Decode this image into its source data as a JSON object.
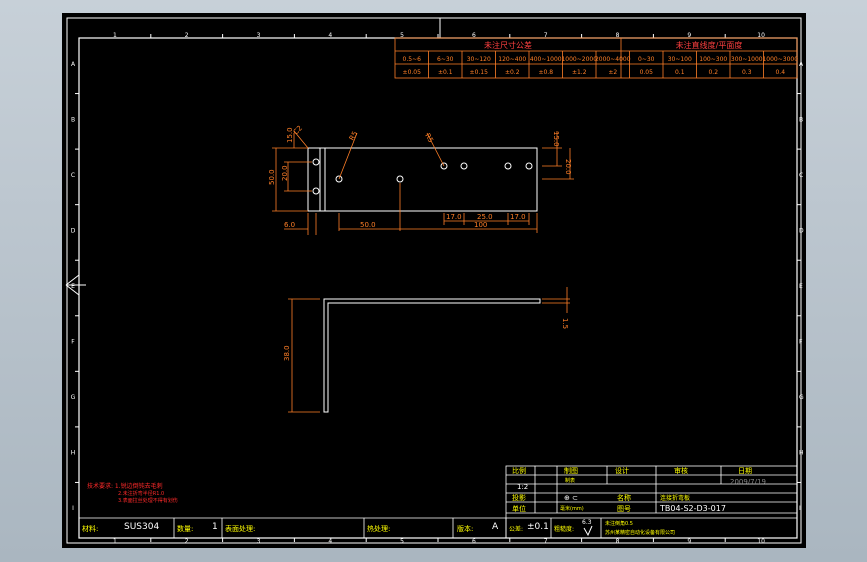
{
  "colors": {
    "sheet": "#000000",
    "frame": "#ffffff",
    "dim": "#ff7f27",
    "title": "#ffff00",
    "note": "#ff2a2a",
    "grid": "#ffffff"
  },
  "grid": {
    "columns": [
      "1",
      "2",
      "3",
      "4",
      "5",
      "6",
      "7",
      "8",
      "9",
      "10"
    ],
    "rows": [
      "A",
      "B",
      "C",
      "D",
      "E",
      "F",
      "G",
      "H",
      "I"
    ]
  },
  "tolerance_table": {
    "header_left": "未注尺寸公差",
    "header_right": "未注直线度/平面度",
    "ranges": [
      "0.5~6",
      "6~30",
      "30~120",
      "120~400",
      "400~1000",
      "1000~2000",
      "2000~4000",
      "0~30",
      "30~100",
      "100~300",
      "300~1000",
      "1000~3000"
    ],
    "values": [
      "±0.05",
      "±0.1",
      "±0.15",
      "±0.2",
      "±0.8",
      "±1.2",
      "±2",
      "0.05",
      "0.1",
      "0.2",
      "0.3",
      "0.4"
    ]
  },
  "top_view": {
    "dim_overall_height": "50.0",
    "dim_inner_height": "20.0",
    "dim_top": "15.0",
    "dim_c": "C2",
    "dim_r1": "R5",
    "dim_r2": "R5",
    "dim_left": "6.0",
    "dim_50": "50.0",
    "dim_100": "100",
    "dim_17a": "17.0",
    "dim_25": "25.0",
    "dim_17b": "17.0",
    "dim_r15": "15.0",
    "dim_r20": "20.0"
  },
  "side_view": {
    "dim_height": "38.0",
    "dim_thk": "1.5"
  },
  "title_block": {
    "scale_label": "比例",
    "scale_value": "1:2",
    "drawn_label": "制图",
    "drawn_value": "制表",
    "design_label": "设计",
    "review_label": "审核",
    "date_label": "日期",
    "date_value": "2009/7/19",
    "proj_label": "投影",
    "proj_symbol": "⊕ ⊂",
    "name_label": "名称",
    "name_value": "连接折弯板",
    "unit_label": "单位",
    "unit_value": "毫米(mm)",
    "drawing_no_label": "图号",
    "drawing_no_value": "TB04-S2-D3-017",
    "material_label": "材料:",
    "material_value": "SUS304",
    "qty_label": "数量:",
    "qty_value": "1",
    "surface_label": "表面处理:",
    "surface_value": "",
    "heat_label": "热处理:",
    "heat_value": "",
    "rev_label": "版本:",
    "rev_value": "A",
    "tol_label": "公差:",
    "tol_value": "±0.1",
    "rough_label": "粗糙度:",
    "rough_value": "6.3",
    "note_tail": "未注倒角0.5",
    "company": "苏州某精密自动化设备有限公司"
  },
  "notes": {
    "title": "技术要求: 1.锐边倒钝去毛刺",
    "line2": "2.未注折弯半径R1.0",
    "line3": "3.表面拉丝处理不得有划伤"
  }
}
